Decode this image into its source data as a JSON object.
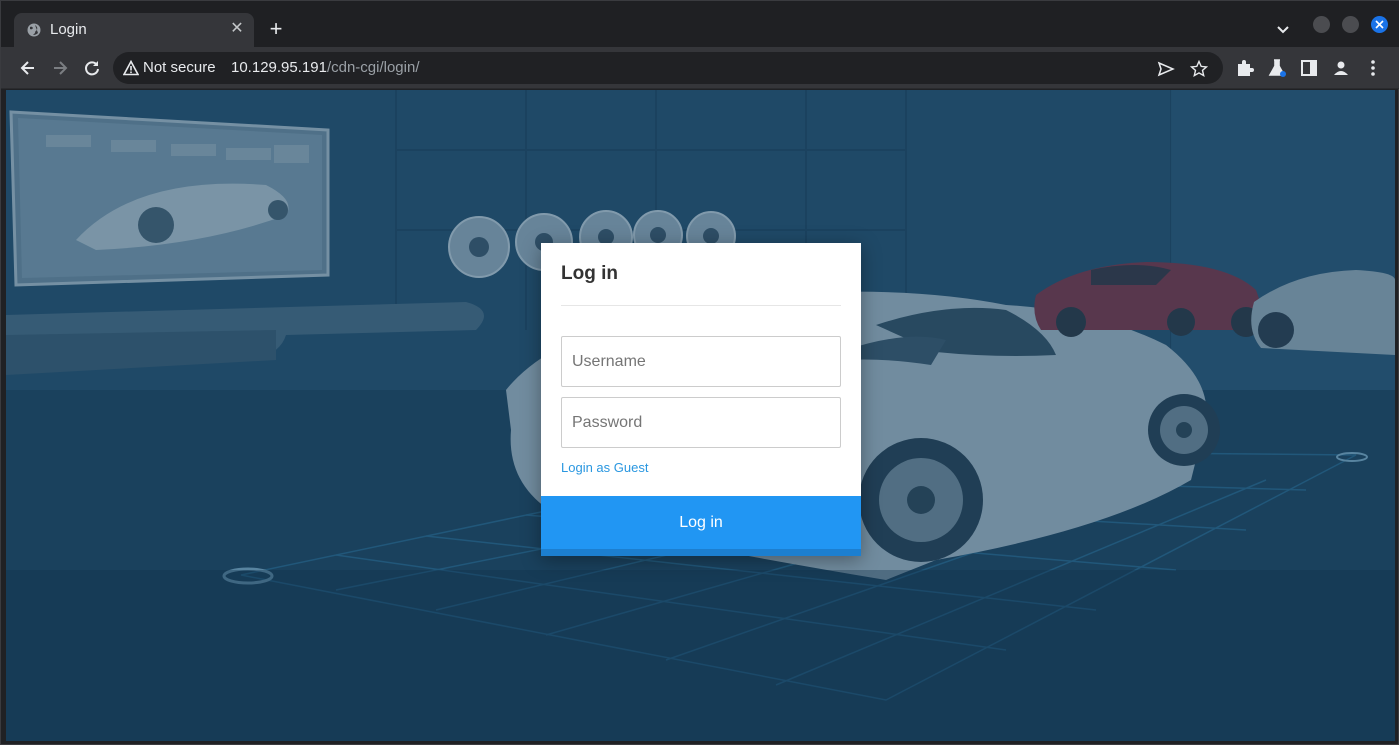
{
  "browser": {
    "tab": {
      "title": "Login",
      "favicon": "globe-icon",
      "close_icon": "close-icon"
    },
    "new_tab_icon": "plus-icon",
    "address_bar": {
      "security_label": "Not secure",
      "security_icon": "warning-icon",
      "host": "10.129.95.191",
      "path": "/cdn-cgi/login/"
    },
    "accent_color": "#1a73e8"
  },
  "login": {
    "title": "Log in",
    "username_placeholder": "Username",
    "password_placeholder": "Password",
    "guest_link": "Login as Guest",
    "submit_label": "Log in",
    "button_color": "#2196f3"
  }
}
